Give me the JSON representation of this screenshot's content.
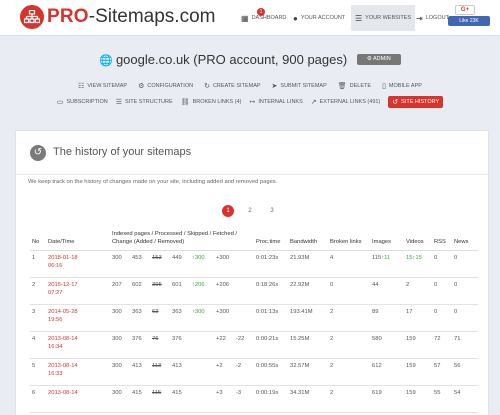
{
  "brand": {
    "pro": "PRO",
    "rest": "-Sitemaps.com"
  },
  "topnav": {
    "dashboard": "DASHBOARD",
    "dashboard_badge": "1",
    "account": "YOUR ACCOUNT",
    "websites": "YOUR WEBSITES",
    "logout": "LOGOUT",
    "gplus": "G+",
    "fblike": "Like 23K"
  },
  "site": {
    "title": "google.co.uk (PRO account, 900 pages)",
    "admin": "ADMIN"
  },
  "menu": {
    "row1": [
      "VIEW SITEMAP",
      "CONFIGURATION",
      "CREATE SITEMAP",
      "SUBMIT SITEMAP",
      "DELETE",
      "MOBILE APP"
    ],
    "row2": [
      "SUBSCRIPTION",
      "SITE STRUCTURE",
      "BROKEN LINKS (4)",
      "INTERNAL LINKS",
      "EXTERNAL LINKS (491)",
      "SITE HISTORY"
    ]
  },
  "card": {
    "title": "The history of your sitemaps",
    "intro": "We keep track on the history of changes made on your site, including added and removed pages."
  },
  "pager": [
    "1",
    "2",
    "3"
  ],
  "table": {
    "headers": {
      "no": "No",
      "datetime": "Date/Time",
      "indexed": "Indexed pages / Processed / Skipped / Fetched / Change (Added / Removed)",
      "proc": "Proc.time",
      "bandwidth": "Bandwidth",
      "broken": "Broken links",
      "images": "Images",
      "videos": "Videos",
      "rss": "RSS",
      "news": "News"
    },
    "rows": [
      {
        "no": "1",
        "date": "2018-01-18",
        "time": "06:16",
        "indexed": "300",
        "processed": "453",
        "skipped": "153",
        "fetched": "449",
        "chg": "↑300",
        "added": "+300",
        "removed": "",
        "proc": "0:01:23s",
        "bw": "21.93M",
        "broken": "4",
        "img": "115",
        "img_chg": "↑11",
        "vid": "15",
        "vid_chg": "↑15",
        "rss": "0",
        "news": "0"
      },
      {
        "no": "2",
        "date": "2015-12-17",
        "time": "07:27",
        "indexed": "207",
        "processed": "602",
        "skipped": "395",
        "fetched": "601",
        "chg": "↑206",
        "added": "+206",
        "removed": "",
        "proc": "0:18:26s",
        "bw": "22.92M",
        "broken": "0",
        "img": "44",
        "img_chg": "",
        "vid": "2",
        "vid_chg": "",
        "rss": "0",
        "news": "0"
      },
      {
        "no": "3",
        "date": "2014-05-28",
        "time": "19:56",
        "indexed": "300",
        "processed": "363",
        "skipped": "63",
        "fetched": "363",
        "chg": "↑300",
        "added": "+300",
        "removed": "",
        "proc": "0:01:13s",
        "bw": "193.41M",
        "broken": "2",
        "img": "89",
        "img_chg": "",
        "vid": "17",
        "vid_chg": "",
        "rss": "0",
        "news": "0"
      },
      {
        "no": "4",
        "date": "2013-08-14",
        "time": "16:34",
        "indexed": "300",
        "processed": "376",
        "skipped": "76",
        "fetched": "376",
        "chg": "",
        "added": "+22",
        "removed": "-22",
        "proc": "0:00:21s",
        "bw": "15.25M",
        "broken": "2",
        "img": "580",
        "img_chg": "",
        "vid": "159",
        "vid_chg": "",
        "rss": "72",
        "news": "71"
      },
      {
        "no": "5",
        "date": "2013-08-14",
        "time": "16:33",
        "indexed": "300",
        "processed": "413",
        "skipped": "113",
        "fetched": "413",
        "chg": "",
        "added": "+2",
        "removed": "-2",
        "proc": "0:00:55s",
        "bw": "32.57M",
        "broken": "2",
        "img": "612",
        "img_chg": "",
        "vid": "159",
        "vid_chg": "",
        "rss": "57",
        "news": "56"
      },
      {
        "no": "6",
        "date": "2013-08-14",
        "time": "",
        "indexed": "300",
        "processed": "415",
        "skipped": "115",
        "fetched": "415",
        "chg": "",
        "added": "+3",
        "removed": "-3",
        "proc": "0:00:19s",
        "bw": "34.31M",
        "broken": "2",
        "img": "619",
        "img_chg": "",
        "vid": "159",
        "vid_chg": "",
        "rss": "55",
        "news": "54"
      }
    ]
  },
  "colors": {
    "brand_red": "#d9332e",
    "green": "#3aa53a",
    "bg": "#e9edf3"
  }
}
